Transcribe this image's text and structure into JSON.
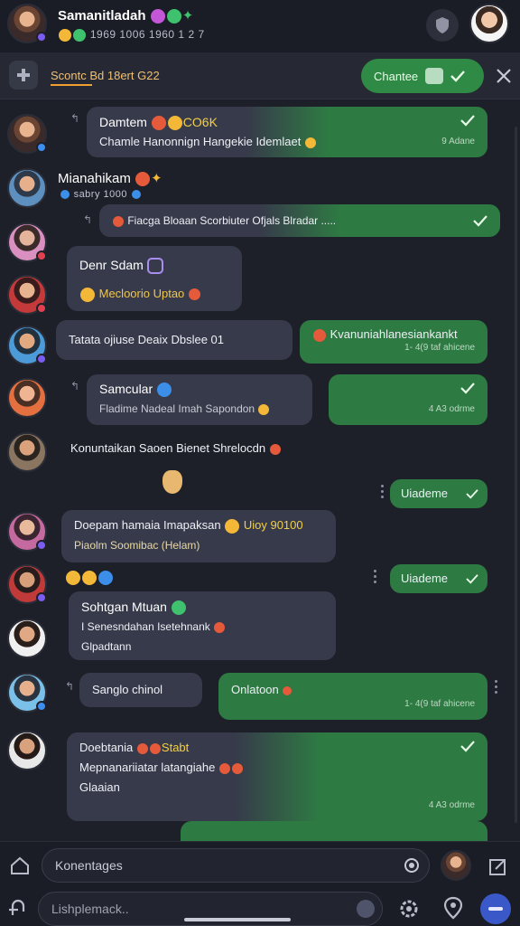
{
  "header": {
    "name": "Samanitladah",
    "subtitle": "1969 1006 1960 1 2 7",
    "icons": [
      "smile",
      "green-emoji",
      "purple-emoji"
    ]
  },
  "search": {
    "text": "Scontc Bd 18ert G22",
    "cta_label": "Chantee"
  },
  "messages": [
    {
      "title": "Damtem",
      "title_extra": "CO6K",
      "body": "Chamle Hanonnign Hangekie Idemlaet",
      "meta": "9 Adane"
    },
    {
      "title": "Mianahikam",
      "sub": "sabry 1000"
    },
    {
      "body": "Fiacga  Bloaan  Scorbiuter  Ofjals  Blradar ....."
    },
    {
      "title": "Denr Sdam"
    },
    {
      "body": "Mecloorio  Uptao"
    },
    {
      "body": "Tatata  ojiuse  Deaix Dbslee 01"
    },
    {
      "body": "Kvanuniahlanesiankankt",
      "meta": "1- 4(9 taf ahicene"
    },
    {
      "title": "Samcular",
      "body": "Fladime Nadeal Imah Sapondon",
      "meta": "4 A3 odrme"
    },
    {
      "body": "Konuntaikan  Saoen  Bienet  Shrelocdn"
    },
    {
      "status": "Uiademe"
    },
    {
      "title": "Doepam hamaia Imapaksan",
      "title_extra": "Uioy 90100",
      "body": "Piaolm Soomibac (Helam)"
    },
    {
      "status": "Uiademe"
    },
    {
      "title": "Sohtgan Mtuan",
      "body": "I Senesndahan Isetehnank",
      "body2": "Glpadtann"
    },
    {
      "body": "Sanglo  chinol"
    },
    {
      "body": "Onlatoon",
      "meta": "1- 4(9 taf ahicene"
    },
    {
      "title": "Doebtania",
      "title_extra": "Stabt",
      "body": "Mepnanariiatar latangiahe",
      "body2": "Glaaian",
      "meta": "4 A3 odrme"
    }
  ],
  "composer": {
    "top_placeholder": "Konentages",
    "bottom_placeholder": "Lishplemack.."
  },
  "colors": {
    "background": "#1e2029",
    "bubble_dark": "#373a4a",
    "bubble_green": "#2e7a43",
    "accent_orange": "#f0a030"
  }
}
